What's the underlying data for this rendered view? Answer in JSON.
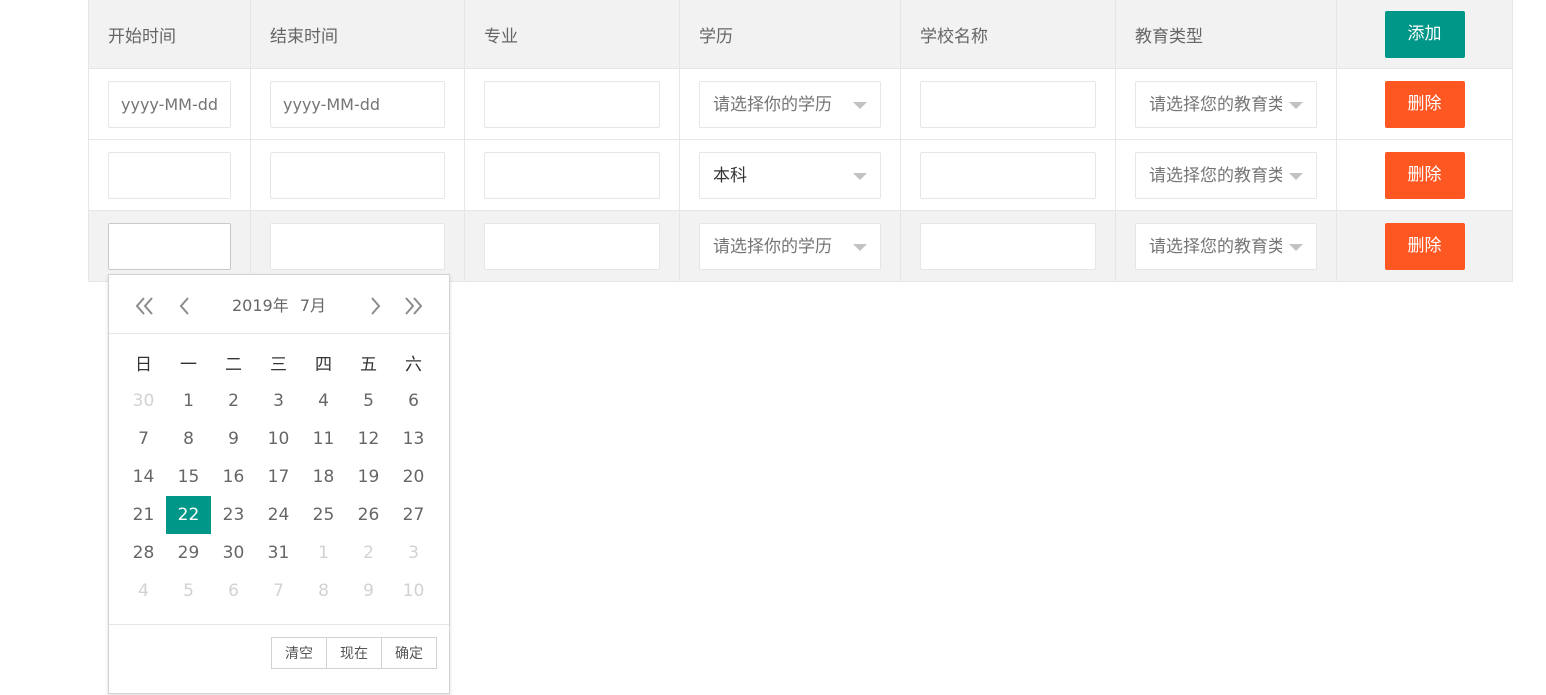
{
  "table": {
    "headers": [
      "开始时间",
      "结束时间",
      "专业",
      "学历",
      "学校名称",
      "教育类型"
    ],
    "add_label": "添加",
    "delete_label": "删除",
    "date_placeholder": "yyyy-MM-dd",
    "degree_placeholder": "请选择你的学历",
    "edu_type_placeholder": "请选择您的教育类型",
    "rows": [
      {
        "start": "",
        "end": "",
        "major": "",
        "degree": "",
        "school": "",
        "edu_type": ""
      },
      {
        "start": "",
        "end": "",
        "major": "",
        "degree": "本科",
        "school": "",
        "edu_type": ""
      },
      {
        "start": "",
        "end": "",
        "major": "",
        "degree": "",
        "school": "",
        "edu_type": ""
      }
    ]
  },
  "datepicker": {
    "year": "2019年",
    "month": "7月",
    "weekdays": [
      "日",
      "一",
      "二",
      "三",
      "四",
      "五",
      "六"
    ],
    "selected_day": 22,
    "days": [
      [
        {
          "d": "30",
          "o": true
        },
        {
          "d": "1"
        },
        {
          "d": "2"
        },
        {
          "d": "3"
        },
        {
          "d": "4"
        },
        {
          "d": "5"
        },
        {
          "d": "6"
        }
      ],
      [
        {
          "d": "7"
        },
        {
          "d": "8"
        },
        {
          "d": "9"
        },
        {
          "d": "10"
        },
        {
          "d": "11"
        },
        {
          "d": "12"
        },
        {
          "d": "13"
        }
      ],
      [
        {
          "d": "14"
        },
        {
          "d": "15"
        },
        {
          "d": "16"
        },
        {
          "d": "17"
        },
        {
          "d": "18"
        },
        {
          "d": "19"
        },
        {
          "d": "20"
        }
      ],
      [
        {
          "d": "21"
        },
        {
          "d": "22",
          "s": true
        },
        {
          "d": "23"
        },
        {
          "d": "24"
        },
        {
          "d": "25"
        },
        {
          "d": "26"
        },
        {
          "d": "27"
        }
      ],
      [
        {
          "d": "28"
        },
        {
          "d": "29"
        },
        {
          "d": "30"
        },
        {
          "d": "31"
        },
        {
          "d": "1",
          "o": true
        },
        {
          "d": "2",
          "o": true
        },
        {
          "d": "3",
          "o": true
        }
      ],
      [
        {
          "d": "4",
          "o": true
        },
        {
          "d": "5",
          "o": true
        },
        {
          "d": "6",
          "o": true
        },
        {
          "d": "7",
          "o": true
        },
        {
          "d": "8",
          "o": true
        },
        {
          "d": "9",
          "o": true
        },
        {
          "d": "10",
          "o": true
        }
      ]
    ],
    "clear_label": "清空",
    "now_label": "现在",
    "confirm_label": "确定"
  },
  "colors": {
    "primary": "#009688",
    "danger": "#ff5722",
    "header_bg": "#f2f2f2",
    "border": "#e6e6e6"
  },
  "icons": {
    "prev_year": "double-chevron-left-icon",
    "prev_month": "chevron-left-icon",
    "next_month": "chevron-right-icon",
    "next_year": "double-chevron-right-icon",
    "dropdown": "caret-down-icon"
  }
}
